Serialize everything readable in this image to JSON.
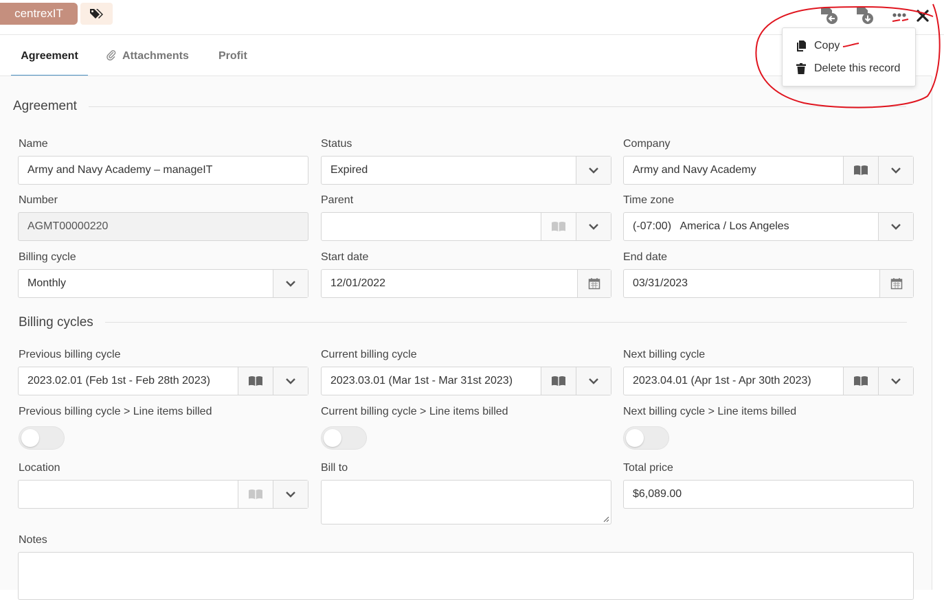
{
  "header": {
    "brand_tag": "centrexIT",
    "tag_icon": "tags-icon",
    "actions": [
      "undo-record-icon",
      "save-record-icon",
      "more-options-icon",
      "close-icon"
    ]
  },
  "tabs": [
    {
      "label": "Agreement",
      "active": true
    },
    {
      "label": "Attachments",
      "icon": "paperclip-icon"
    },
    {
      "label": "Profit"
    }
  ],
  "menu": {
    "items": [
      {
        "label": "Copy",
        "icon": "copy-icon"
      },
      {
        "label": "Delete this record",
        "icon": "trash-icon"
      }
    ]
  },
  "sections": {
    "agreement": "Agreement",
    "billing_cycles": "Billing cycles"
  },
  "fields": {
    "name": {
      "label": "Name",
      "value": "Army and Navy Academy – manageIT"
    },
    "status": {
      "label": "Status",
      "value": "Expired"
    },
    "company": {
      "label": "Company",
      "value": "Army and Navy Academy"
    },
    "number": {
      "label": "Number",
      "value": "AGMT00000220"
    },
    "parent": {
      "label": "Parent",
      "value": ""
    },
    "time_zone": {
      "label": "Time zone",
      "value": "(-07:00)   America / Los Angeles"
    },
    "billing_cycle": {
      "label": "Billing cycle",
      "value": "Monthly"
    },
    "start_date": {
      "label": "Start date",
      "value": "12/01/2022"
    },
    "end_date": {
      "label": "End date",
      "value": "03/31/2023"
    },
    "previous_billing_cycle": {
      "label": "Previous billing cycle",
      "value": "2023.02.01 (Feb 1st - Feb 28th 2023)"
    },
    "current_billing_cycle": {
      "label": "Current billing cycle",
      "value": "2023.03.01 (Mar 1st - Mar 31st 2023)"
    },
    "next_billing_cycle": {
      "label": "Next billing cycle",
      "value": "2023.04.01 (Apr 1st - Apr 30th 2023)"
    },
    "prev_line_items_billed": {
      "label": "Previous billing cycle > Line items billed",
      "value": false
    },
    "curr_line_items_billed": {
      "label": "Current billing cycle > Line items billed",
      "value": false
    },
    "next_line_items_billed": {
      "label": "Next billing cycle > Line items billed",
      "value": false
    },
    "location": {
      "label": "Location",
      "value": ""
    },
    "bill_to": {
      "label": "Bill to",
      "value": ""
    },
    "total_price": {
      "label": "Total price",
      "value": "$6,089.00"
    },
    "notes": {
      "label": "Notes",
      "value": ""
    }
  },
  "colors": {
    "brand_tag_bg": "#c58f7e",
    "tag_button_bg": "#fbeee4",
    "active_tab_underline": "#4a90c2",
    "annotation": "#e0141e"
  }
}
